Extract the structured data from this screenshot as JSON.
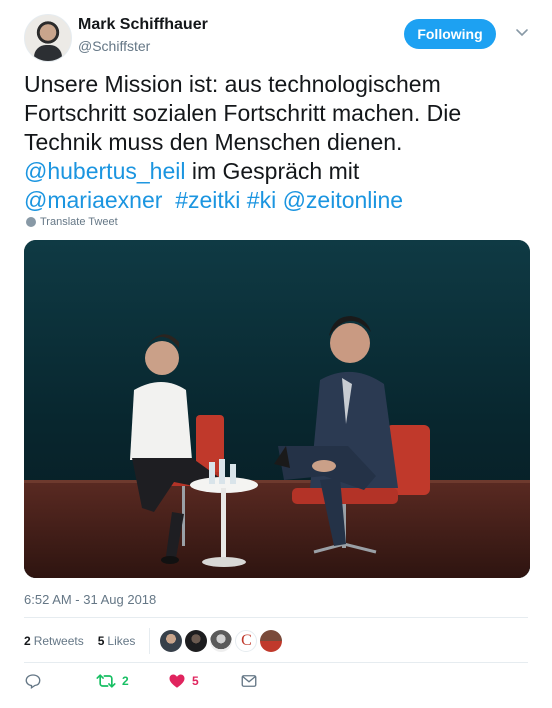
{
  "author": {
    "name": "Mark Schiffhauer",
    "handle": "@Schiffster"
  },
  "follow_button_label": "Following",
  "tweet": {
    "line1": "Unsere Mission ist: aus technologischem",
    "line2": "Fortschritt sozialen Fortschritt machen. Die",
    "line3": "Technik muss den Menschen dienen.",
    "mention_hubertus": "@hubertus_heil",
    "text_im_gesprach": " im Gespräch mit",
    "mention_maria": "@mariaexner",
    "hashtag_zeitki": "#zeitki",
    "hashtag_ki": "#ki",
    "mention_zeitonline": "@zeitonline"
  },
  "translate_label": "Translate Tweet",
  "timestamp": "6:52 AM - 31 Aug 2018",
  "stats": {
    "retweets_count": "2",
    "retweets_label": "Retweets",
    "likes_count": "5",
    "likes_label": "Likes"
  },
  "actions": {
    "retweet_count": "2",
    "like_count": "5"
  },
  "likers": [
    {
      "icon": "avatar-person"
    },
    {
      "icon": "avatar-dark"
    },
    {
      "icon": "avatar-bw"
    },
    {
      "icon": "avatar-letter-c",
      "letter": "C"
    },
    {
      "icon": "avatar-red"
    }
  ],
  "colors": {
    "link": "#1b95e0",
    "follow_bg": "#1da1f2",
    "retweet": "#17bf63",
    "like": "#e0245e",
    "muted": "#657786"
  }
}
